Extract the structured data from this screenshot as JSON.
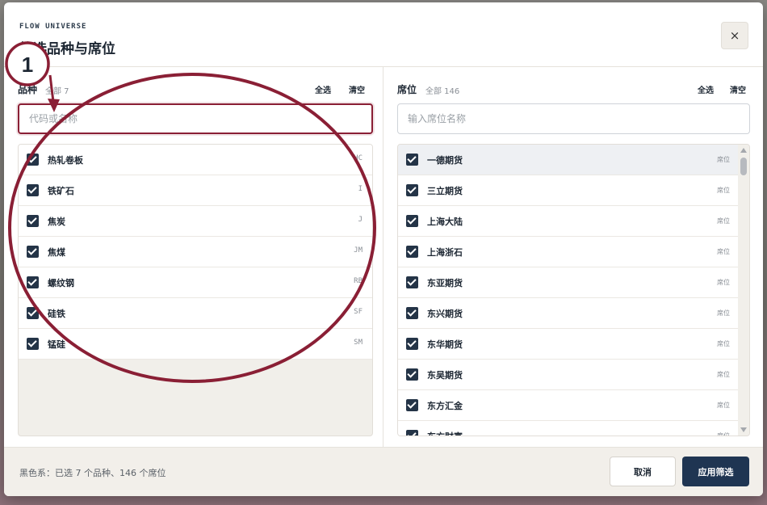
{
  "header": {
    "eyebrow": "FLOW UNIVERSE",
    "title": "筛选品种与席位",
    "close_label": "×"
  },
  "left_panel": {
    "title": "品种",
    "count": "全部 7",
    "select_all": "全选",
    "clear": "清空",
    "search_value": "",
    "search_placeholder": "代码或名称",
    "items": [
      {
        "label": "热轧卷板",
        "code": "HC",
        "checked": true
      },
      {
        "label": "铁矿石",
        "code": "I",
        "checked": true
      },
      {
        "label": "焦炭",
        "code": "J",
        "checked": true
      },
      {
        "label": "焦煤",
        "code": "JM",
        "checked": true
      },
      {
        "label": "螺纹钢",
        "code": "RB",
        "checked": true
      },
      {
        "label": "硅铁",
        "code": "SF",
        "checked": true
      },
      {
        "label": "锰硅",
        "code": "SM",
        "checked": true
      }
    ]
  },
  "right_panel": {
    "title": "席位",
    "count": "全部 146",
    "select_all": "全选",
    "clear": "清空",
    "search_value": "",
    "search_placeholder": "输入席位名称",
    "items": [
      {
        "label": "一德期货",
        "tag": "席位",
        "checked": true
      },
      {
        "label": "三立期货",
        "tag": "席位",
        "checked": true
      },
      {
        "label": "上海大陆",
        "tag": "席位",
        "checked": true
      },
      {
        "label": "上海浙石",
        "tag": "席位",
        "checked": true
      },
      {
        "label": "东亚期货",
        "tag": "席位",
        "checked": true
      },
      {
        "label": "东兴期货",
        "tag": "席位",
        "checked": true
      },
      {
        "label": "东华期货",
        "tag": "席位",
        "checked": true
      },
      {
        "label": "东吴期货",
        "tag": "席位",
        "checked": true
      },
      {
        "label": "东方汇金",
        "tag": "席位",
        "checked": true
      },
      {
        "label": "东方财富",
        "tag": "席位",
        "checked": true
      }
    ]
  },
  "footer": {
    "status": "黑色系：已选 7 个品种、146 个席位",
    "cancel_label": "取消",
    "apply_label": "应用筛选"
  },
  "annotation": {
    "number": "1",
    "color": "#8a1f35"
  },
  "colors": {
    "accent": "#8a1f35",
    "primary": "#1f3552",
    "checkbox": "#243447"
  }
}
